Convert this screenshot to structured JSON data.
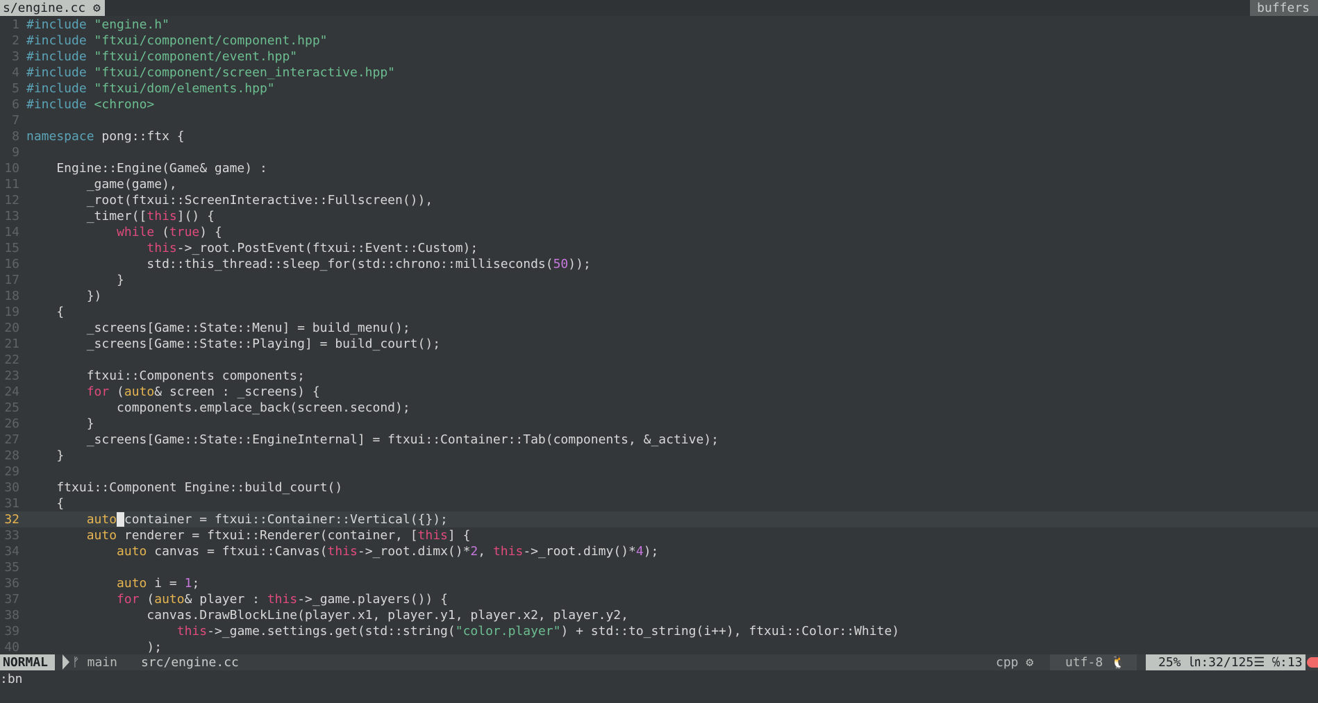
{
  "tabline": {
    "active_tab": "s/engine.cc ⚙",
    "buffers_label": "buffers"
  },
  "editor": {
    "current_line": 32,
    "lines": [
      {
        "n": "1",
        "tokens": [
          [
            "pp",
            "#include "
          ],
          [
            "str",
            "\"engine.h\""
          ]
        ]
      },
      {
        "n": "2",
        "tokens": [
          [
            "pp",
            "#include "
          ],
          [
            "str",
            "\"ftxui/component/component.hpp\""
          ]
        ]
      },
      {
        "n": "3",
        "tokens": [
          [
            "pp",
            "#include "
          ],
          [
            "str",
            "\"ftxui/component/event.hpp\""
          ]
        ]
      },
      {
        "n": "4",
        "tokens": [
          [
            "pp",
            "#include "
          ],
          [
            "str",
            "\"ftxui/component/screen_interactive.hpp\""
          ]
        ]
      },
      {
        "n": "5",
        "tokens": [
          [
            "pp",
            "#include "
          ],
          [
            "str",
            "\"ftxui/dom/elements.hpp\""
          ]
        ]
      },
      {
        "n": "6",
        "tokens": [
          [
            "pp",
            "#include "
          ],
          [
            "str",
            "<chrono>"
          ]
        ]
      },
      {
        "n": "7",
        "tokens": []
      },
      {
        "n": "8",
        "tokens": [
          [
            "ns",
            "namespace"
          ],
          [
            "txt",
            " pong::ftx {"
          ]
        ]
      },
      {
        "n": "9",
        "tokens": []
      },
      {
        "n": "10",
        "tokens": [
          [
            "txt",
            "    Engine::Engine(Game& game) :"
          ]
        ]
      },
      {
        "n": "11",
        "tokens": [
          [
            "txt",
            "        _game(game),"
          ]
        ]
      },
      {
        "n": "12",
        "tokens": [
          [
            "txt",
            "        _root(ftxui::ScreenInteractive::Fullscreen()),"
          ]
        ]
      },
      {
        "n": "13",
        "tokens": [
          [
            "txt",
            "        _timer(["
          ],
          [
            "kw",
            "this"
          ],
          [
            "txt",
            "]() {"
          ]
        ]
      },
      {
        "n": "14",
        "tokens": [
          [
            "txt",
            "            "
          ],
          [
            "kw",
            "while"
          ],
          [
            "txt",
            " ("
          ],
          [
            "kw",
            "true"
          ],
          [
            "txt",
            ") {"
          ]
        ]
      },
      {
        "n": "15",
        "tokens": [
          [
            "txt",
            "                "
          ],
          [
            "kw",
            "this"
          ],
          [
            "txt",
            "->_root.PostEvent(ftxui::Event::Custom);"
          ]
        ]
      },
      {
        "n": "16",
        "tokens": [
          [
            "txt",
            "                std::this_thread::sleep_for(std::chrono::milliseconds("
          ],
          [
            "num",
            "50"
          ],
          [
            "txt",
            "));"
          ]
        ]
      },
      {
        "n": "17",
        "tokens": [
          [
            "txt",
            "            }"
          ]
        ]
      },
      {
        "n": "18",
        "tokens": [
          [
            "txt",
            "        })"
          ]
        ]
      },
      {
        "n": "19",
        "tokens": [
          [
            "txt",
            "    {"
          ]
        ]
      },
      {
        "n": "20",
        "tokens": [
          [
            "txt",
            "        _screens[Game::State::Menu] = build_menu();"
          ]
        ]
      },
      {
        "n": "21",
        "tokens": [
          [
            "txt",
            "        _screens[Game::State::Playing] = build_court();"
          ]
        ]
      },
      {
        "n": "22",
        "tokens": []
      },
      {
        "n": "23",
        "tokens": [
          [
            "txt",
            "        ftxui::Components components;"
          ]
        ]
      },
      {
        "n": "24",
        "tokens": [
          [
            "txt",
            "        "
          ],
          [
            "kw",
            "for"
          ],
          [
            "txt",
            " ("
          ],
          [
            "type",
            "auto"
          ],
          [
            "txt",
            "& screen : _screens) {"
          ]
        ]
      },
      {
        "n": "25",
        "tokens": [
          [
            "txt",
            "            components.emplace_back(screen.second);"
          ]
        ]
      },
      {
        "n": "26",
        "tokens": [
          [
            "txt",
            "        }"
          ]
        ]
      },
      {
        "n": "27",
        "tokens": [
          [
            "txt",
            "        _screens[Game::State::EngineInternal] = ftxui::Container::Tab(components, &_active);"
          ]
        ]
      },
      {
        "n": "28",
        "tokens": [
          [
            "txt",
            "    }"
          ]
        ]
      },
      {
        "n": "29",
        "tokens": []
      },
      {
        "n": "30",
        "tokens": [
          [
            "txt",
            "    ftxui::Component Engine::build_court()"
          ]
        ]
      },
      {
        "n": "31",
        "tokens": [
          [
            "txt",
            "    {"
          ]
        ]
      },
      {
        "n": "32",
        "tokens": [
          [
            "txt",
            "        "
          ],
          [
            "type",
            "auto"
          ],
          [
            "cursor",
            " "
          ],
          [
            "txt",
            "container = ftxui::Container::Vertical({});"
          ]
        ]
      },
      {
        "n": "33",
        "tokens": [
          [
            "txt",
            "        "
          ],
          [
            "type",
            "auto"
          ],
          [
            "txt",
            " renderer = ftxui::Renderer(container, ["
          ],
          [
            "kw",
            "this"
          ],
          [
            "txt",
            "] {"
          ]
        ]
      },
      {
        "n": "34",
        "tokens": [
          [
            "txt",
            "            "
          ],
          [
            "type",
            "auto"
          ],
          [
            "txt",
            " canvas = ftxui::Canvas("
          ],
          [
            "kw",
            "this"
          ],
          [
            "txt",
            "->_root.dimx()*"
          ],
          [
            "num",
            "2"
          ],
          [
            "txt",
            ", "
          ],
          [
            "kw",
            "this"
          ],
          [
            "txt",
            "->_root.dimy()*"
          ],
          [
            "num",
            "4"
          ],
          [
            "txt",
            ");"
          ]
        ]
      },
      {
        "n": "35",
        "tokens": []
      },
      {
        "n": "36",
        "tokens": [
          [
            "txt",
            "            "
          ],
          [
            "type",
            "auto"
          ],
          [
            "txt",
            " i = "
          ],
          [
            "num",
            "1"
          ],
          [
            "txt",
            ";"
          ]
        ]
      },
      {
        "n": "37",
        "tokens": [
          [
            "txt",
            "            "
          ],
          [
            "kw",
            "for"
          ],
          [
            "txt",
            " ("
          ],
          [
            "type",
            "auto"
          ],
          [
            "txt",
            "& player : "
          ],
          [
            "kw",
            "this"
          ],
          [
            "txt",
            "->_game.players()) {"
          ]
        ]
      },
      {
        "n": "38",
        "tokens": [
          [
            "txt",
            "                canvas.DrawBlockLine(player.x1, player.y1, player.x2, player.y2,"
          ]
        ]
      },
      {
        "n": "39",
        "tokens": [
          [
            "txt",
            "                    "
          ],
          [
            "kw",
            "this"
          ],
          [
            "txt",
            "->_game.settings.get(std::string("
          ],
          [
            "str",
            "\"color.player\""
          ],
          [
            "txt",
            ") + std::to_string(i++), ftxui::Color::White)"
          ]
        ]
      },
      {
        "n": "40",
        "tokens": [
          [
            "txt",
            "                );"
          ]
        ]
      }
    ]
  },
  "statusline": {
    "mode": "NORMAL",
    "branch": "ᚠ main",
    "separator": "",
    "file_path": "src/engine.cc",
    "filetype": "cpp ⚙",
    "encoding": "utf-8 🐧",
    "position": "25% ㏑:32/125☰ ℅:13"
  },
  "cmdline": {
    "text": ":bn"
  },
  "colors": {
    "background": "#333739",
    "preprocessor": "#5ba4b8",
    "string": "#6cbe91",
    "keyword": "#e04b7c",
    "type": "#e6b450",
    "number": "#c678dd",
    "current_line_number": "#e6b450",
    "mode_background": "#bfc4c1",
    "warning": "#f06a6a"
  }
}
